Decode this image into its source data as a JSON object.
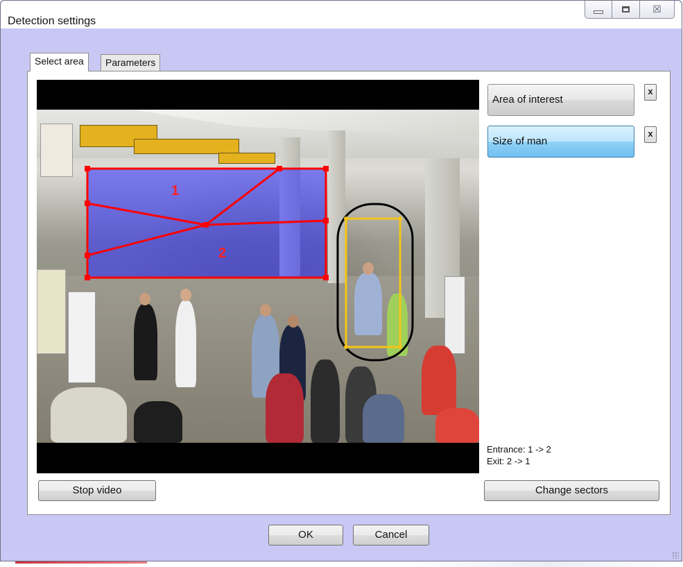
{
  "window": {
    "title": "Detection settings",
    "controls": [
      "minimize-icon",
      "maximize-icon",
      "close-icon"
    ],
    "close_glyph": "☒"
  },
  "tabs": [
    {
      "label": "Select area",
      "active": true
    },
    {
      "label": "Parameters",
      "active": false
    }
  ],
  "video": {
    "sector_labels": [
      "1",
      "2"
    ],
    "area_color": "#ff0000",
    "size_color": "#f5c518",
    "selection_color": "#000000",
    "fill_color": "#2020ff"
  },
  "sidebar": {
    "items": [
      {
        "label": "Area of interest",
        "selected": false,
        "remove_label": "x"
      },
      {
        "label": "Size of man",
        "selected": true,
        "remove_label": "x"
      }
    ]
  },
  "info": {
    "entrance": "Entrance: 1 -> 2",
    "exit": "Exit: 2 -> 1"
  },
  "buttons": {
    "stop_video": "Stop video",
    "change_sectors": "Change sectors",
    "ok": "OK",
    "cancel": "Cancel"
  }
}
